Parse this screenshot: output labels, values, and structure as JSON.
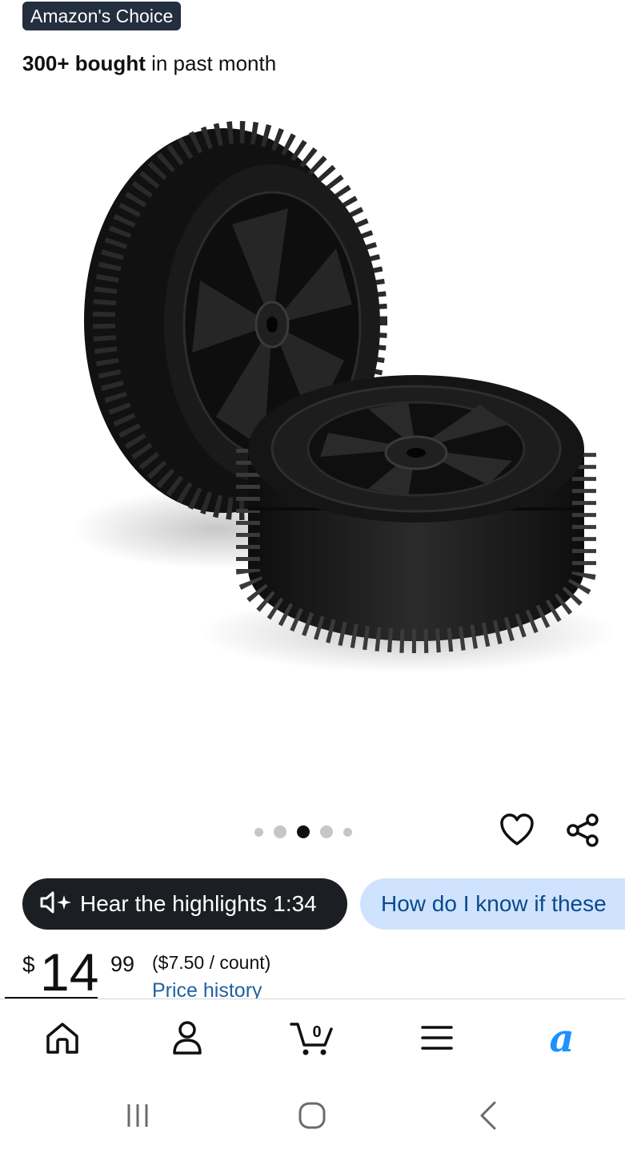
{
  "badge": {
    "label": "Amazon's Choice"
  },
  "bought": {
    "bold": "300+ bought",
    "rest": " in past month"
  },
  "carousel": {
    "dot_count": 5,
    "active_index": 2
  },
  "audio": {
    "label": "Hear the highlights 1:34",
    "icon": "speaker-sparkle-icon"
  },
  "ask": {
    "label": "How do I know if these"
  },
  "price": {
    "symbol": "$",
    "whole": "14",
    "fraction": "99",
    "unit": "($7.50 / count)",
    "history_link": "Price history"
  },
  "bottom_nav": {
    "items": [
      "home-icon",
      "account-icon",
      "cart-icon",
      "menu-icon",
      "rufus-icon"
    ],
    "cart_count": "0",
    "rufus_glyph": "a"
  },
  "colors": {
    "badge_bg": "#232f3e",
    "link": "#2162a1",
    "ask_bg": "#cfe3ff",
    "rufus": "#1e90ff"
  }
}
